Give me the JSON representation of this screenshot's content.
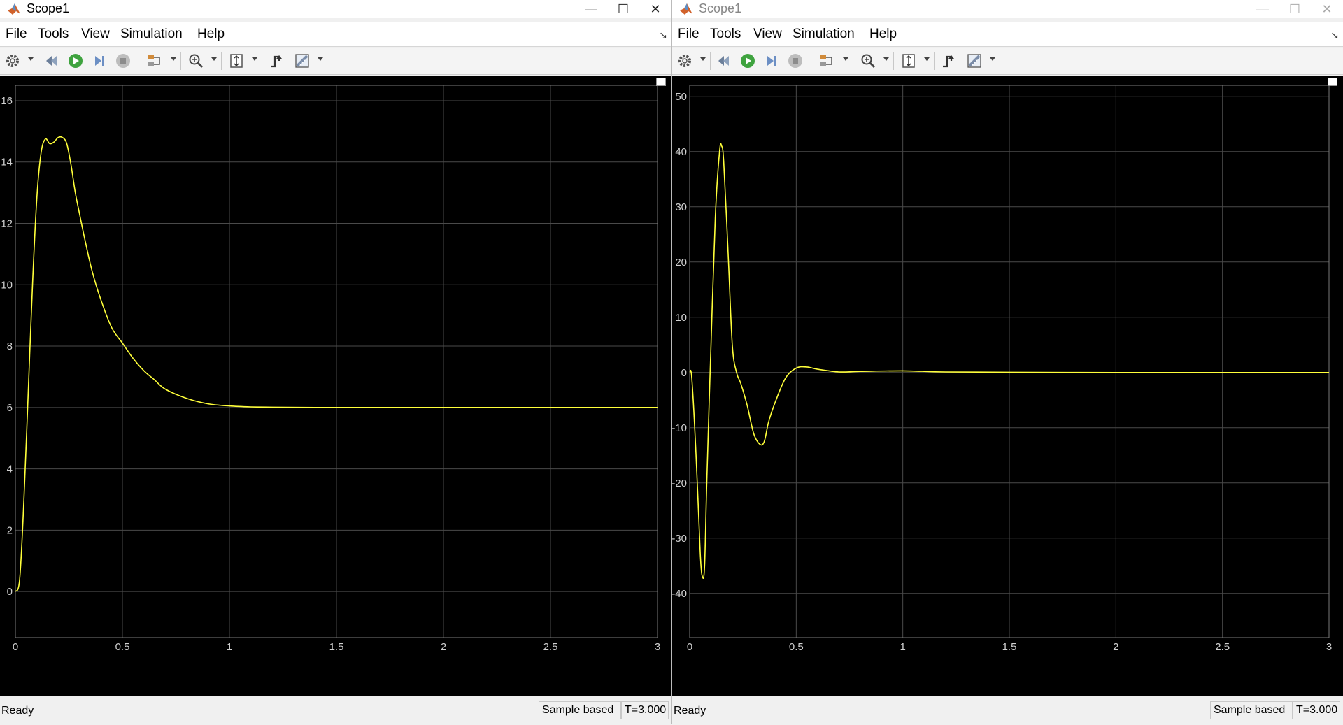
{
  "colors": {
    "plot_bg": "#000000",
    "trace": "#ffff3a",
    "grid": "#4a4a4a",
    "tick_text": "#d0d0d0"
  },
  "windows": [
    {
      "title": "Scope1",
      "active": true,
      "menu": [
        "File",
        "Tools",
        "View",
        "Simulation",
        "Help"
      ],
      "toolbar_icons": [
        "settings-icon",
        "revert-icon",
        "run-icon",
        "step-forward-icon",
        "stop-icon",
        "highlight-block-icon",
        "zoom-in-icon",
        "scale-axes-icon",
        "triggers-icon",
        "measurements-icon"
      ],
      "status": {
        "left": "Ready",
        "mode": "Sample based",
        "time": "T=3.000"
      }
    },
    {
      "title": "Scope1",
      "active": false,
      "menu": [
        "File",
        "Tools",
        "View",
        "Simulation",
        "Help"
      ],
      "toolbar_icons": [
        "settings-icon",
        "revert-icon",
        "run-icon",
        "step-forward-icon",
        "stop-icon",
        "highlight-block-icon",
        "zoom-in-icon",
        "scale-axes-icon",
        "triggers-icon",
        "measurements-icon"
      ],
      "status": {
        "left": "Ready",
        "mode": "Sample based",
        "time": "T=3.000"
      }
    }
  ],
  "chart_data": [
    {
      "type": "line",
      "xlim": [
        0,
        3
      ],
      "ylim": [
        -1.5,
        16.5
      ],
      "x_ticks": [
        0,
        0.5,
        1,
        1.5,
        2,
        2.5,
        3
      ],
      "x_tick_labels": [
        "0",
        "0.5",
        "1",
        "1.5",
        "2",
        "2.5",
        "3"
      ],
      "y_ticks": [
        0,
        2,
        4,
        6,
        8,
        10,
        12,
        14,
        16
      ],
      "y_tick_labels": [
        "0",
        "2",
        "4",
        "6",
        "8",
        "10",
        "12",
        "14",
        "16"
      ],
      "grid": true,
      "series": [
        {
          "x": [
            0,
            0.02,
            0.04,
            0.06,
            0.08,
            0.1,
            0.12,
            0.14,
            0.16,
            0.18,
            0.2,
            0.22,
            0.24,
            0.26,
            0.28,
            0.3,
            0.33,
            0.36,
            0.4,
            0.45,
            0.5,
            0.55,
            0.6,
            0.65,
            0.7,
            0.8,
            0.9,
            1.0,
            1.1,
            1.2,
            1.4,
            1.6,
            2.0,
            2.5,
            3.0
          ],
          "y": [
            0,
            0.4,
            3.0,
            6.5,
            10.0,
            12.8,
            14.3,
            14.75,
            14.6,
            14.65,
            14.8,
            14.8,
            14.6,
            13.9,
            13.0,
            12.3,
            11.3,
            10.4,
            9.5,
            8.6,
            8.1,
            7.6,
            7.2,
            6.9,
            6.6,
            6.3,
            6.12,
            6.05,
            6.02,
            6.01,
            6.0,
            6.0,
            6.0,
            6.0,
            6.0
          ]
        }
      ]
    },
    {
      "type": "line",
      "xlim": [
        0,
        3
      ],
      "ylim": [
        -48,
        52
      ],
      "x_ticks": [
        0,
        0.5,
        1,
        1.5,
        2,
        2.5,
        3
      ],
      "x_tick_labels": [
        "0",
        "0.5",
        "1",
        "1.5",
        "2",
        "2.5",
        "3"
      ],
      "y_ticks": [
        -40,
        -30,
        -20,
        -10,
        0,
        10,
        20,
        30,
        40,
        50
      ],
      "y_tick_labels": [
        "-40",
        "-30",
        "-20",
        "-10",
        "0",
        "10",
        "20",
        "30",
        "40",
        "50"
      ],
      "grid": true,
      "series": [
        {
          "x": [
            0,
            0.01,
            0.03,
            0.05,
            0.06,
            0.07,
            0.08,
            0.1,
            0.12,
            0.14,
            0.15,
            0.16,
            0.18,
            0.2,
            0.22,
            0.24,
            0.27,
            0.3,
            0.33,
            0.35,
            0.37,
            0.4,
            0.45,
            0.5,
            0.55,
            0.6,
            0.7,
            0.8,
            1.0,
            1.2,
            1.5,
            2.0,
            2.5,
            3.0
          ],
          "y": [
            0,
            -1,
            -15,
            -33,
            -37,
            -35,
            -20,
            5,
            28,
            40,
            41,
            38,
            22,
            5,
            0,
            -2,
            -6,
            -11,
            -13,
            -12.5,
            -9,
            -5.5,
            -1,
            0.8,
            1.0,
            0.6,
            0.1,
            0.2,
            0.3,
            0.1,
            0.05,
            0.0,
            0.0,
            0.0
          ]
        }
      ]
    }
  ]
}
